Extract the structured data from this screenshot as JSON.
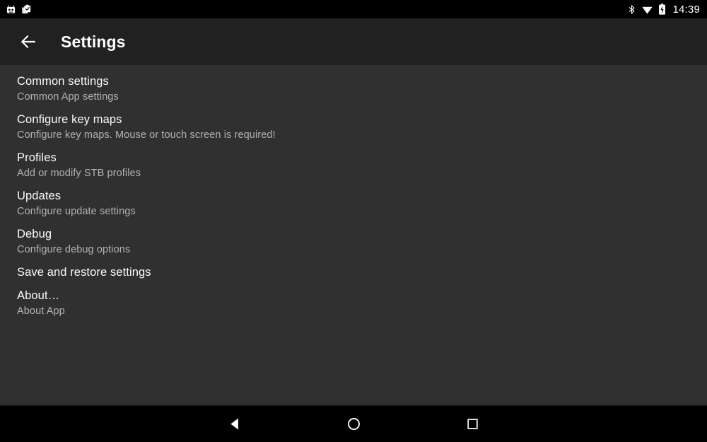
{
  "status_bar": {
    "left_icons": [
      {
        "name": "robot-face-notification-icon",
        "label": "robot-face"
      },
      {
        "name": "clipboard-check-notification-icon",
        "label": "clipboard-check"
      }
    ],
    "right_icons": [
      {
        "name": "bluetooth-icon",
        "label": "bluetooth"
      },
      {
        "name": "wifi-icon",
        "label": "wifi"
      },
      {
        "name": "battery-charging-icon",
        "label": "battery-charging"
      }
    ],
    "clock": "14:39",
    "background_color": "#000000"
  },
  "app_bar": {
    "back_label": "Back",
    "title": "Settings",
    "background_color": "#212121",
    "title_color": "#ffffff"
  },
  "content": {
    "background_color": "#303030",
    "title_color": "#fafafa",
    "subtitle_color": "#b2b2b2",
    "items": [
      {
        "title": "Common settings",
        "subtitle": "Common App settings"
      },
      {
        "title": "Configure key maps",
        "subtitle": "Configure key maps. Mouse or touch screen is required!"
      },
      {
        "title": "Profiles",
        "subtitle": "Add or modify STB profiles"
      },
      {
        "title": "Updates",
        "subtitle": "Configure update settings"
      },
      {
        "title": "Debug",
        "subtitle": "Configure debug options"
      },
      {
        "title": "Save and restore settings",
        "subtitle": ""
      },
      {
        "title": "About…",
        "subtitle": "About App"
      }
    ]
  },
  "nav_bar": {
    "background_color": "#000000",
    "buttons": [
      {
        "name": "nav-back-button",
        "label": "Back"
      },
      {
        "name": "nav-home-button",
        "label": "Home"
      },
      {
        "name": "nav-recents-button",
        "label": "Recents"
      }
    ]
  }
}
